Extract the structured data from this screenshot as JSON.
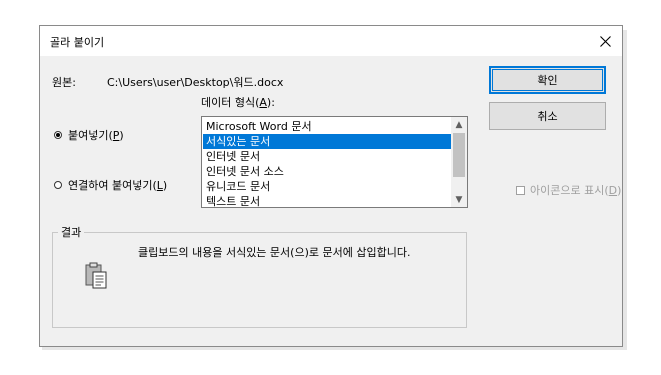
{
  "dialog": {
    "title": "골라 붙이기",
    "source_label": "원본:",
    "source_path": "C:\\Users\\user\\Desktop\\워드.docx",
    "format_label": "데이터 형식(",
    "format_key": "A",
    "format_label_end": "):"
  },
  "options": {
    "paste": {
      "label": "붙여넣기(",
      "key": "P",
      "end": ")",
      "selected": true
    },
    "paste_link": {
      "label": "연결하여 붙여넣기(",
      "key": "L",
      "end": ")",
      "selected": false
    }
  },
  "formats": [
    {
      "label": "Microsoft Word 문서",
      "selected": false
    },
    {
      "label": "서식있는 문서",
      "selected": true
    },
    {
      "label": "인터넷 문서",
      "selected": false
    },
    {
      "label": "인터넷 문서 소스",
      "selected": false
    },
    {
      "label": "유니코드 문서",
      "selected": false
    },
    {
      "label": "텍스트 문서",
      "selected": false
    }
  ],
  "buttons": {
    "ok": "확인",
    "cancel": "취소"
  },
  "checkbox": {
    "label": "아이콘으로 표시(",
    "key": "D",
    "end": ")",
    "checked": false
  },
  "result": {
    "group_label": "결과",
    "text": "클립보드의 내용을 서식있는 문서(으)로 문서에 삽입합니다."
  },
  "icons": {
    "close": "close-icon",
    "clipboard": "clipboard-icon"
  },
  "colors": {
    "selection": "#0078d7",
    "default_button_border": "#0078d7",
    "disabled_text": "#a0a0a0"
  }
}
